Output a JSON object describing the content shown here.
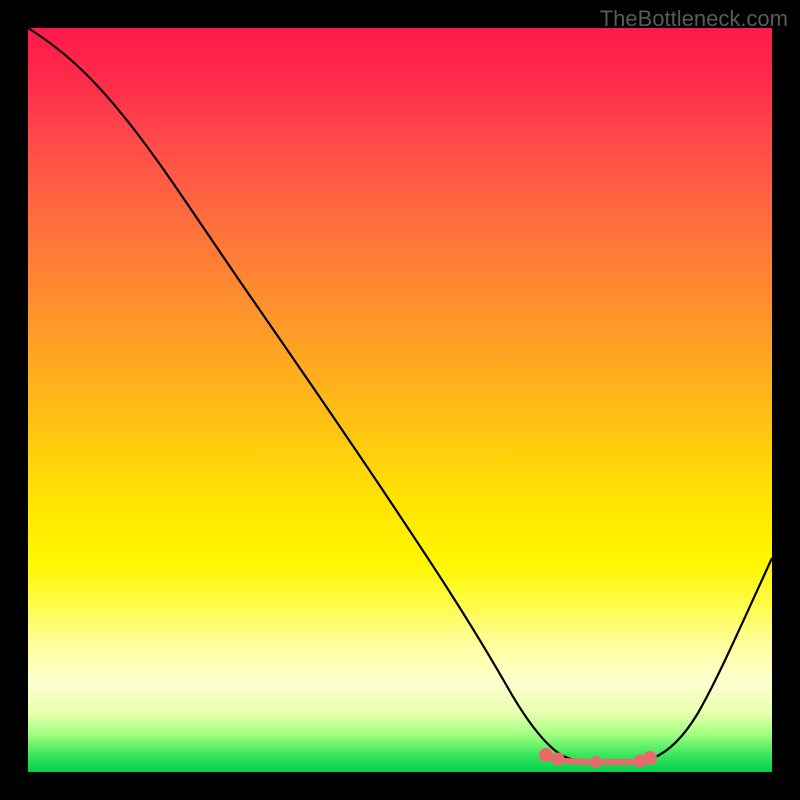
{
  "watermark": "TheBottleneck.com",
  "chart_data": {
    "type": "line",
    "title": "",
    "xlabel": "",
    "ylabel": "",
    "xlim": [
      0,
      100
    ],
    "ylim": [
      0,
      100
    ],
    "series": [
      {
        "name": "bottleneck-curve",
        "x": [
          0,
          5,
          10,
          15,
          20,
          25,
          30,
          35,
          40,
          45,
          50,
          55,
          60,
          63,
          67,
          70,
          73,
          76,
          79,
          82,
          85,
          88,
          92,
          96,
          100
        ],
        "values": [
          100,
          97,
          93,
          87,
          80,
          73,
          65,
          58,
          50,
          43,
          35,
          28,
          20,
          14,
          8,
          4,
          2,
          1.5,
          1.5,
          1.5,
          2,
          4,
          10,
          20,
          30
        ]
      },
      {
        "name": "optimal-range",
        "x": [
          70,
          72,
          74,
          76,
          78,
          80,
          82,
          84
        ],
        "values": [
          2.5,
          2,
          2,
          2,
          2,
          2,
          2,
          2.5
        ]
      }
    ],
    "annotations": []
  },
  "colors": {
    "curve": "#000000",
    "optimal_marker": "#e86a6a",
    "background_top": "#ff1a4a",
    "background_bottom": "#00d048"
  }
}
